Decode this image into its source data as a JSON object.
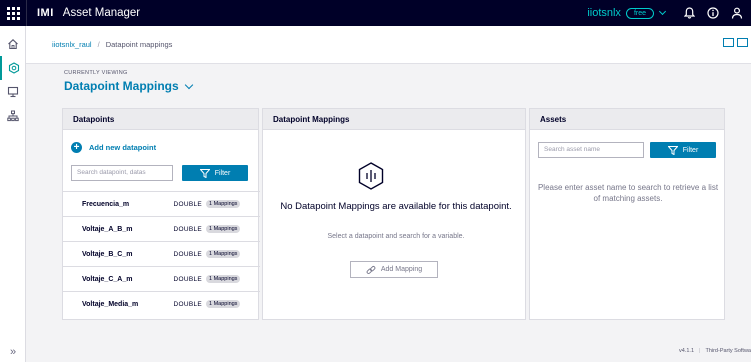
{
  "topbar": {
    "brand": "IMI",
    "app_title": "Asset Manager",
    "tenant": "iiotsnlx",
    "plan_badge": "free"
  },
  "breadcrumb": {
    "root": "iiotsnlx_raul",
    "separator": "/",
    "current": "Datapoint mappings"
  },
  "header": {
    "viewing_label": "CURRENTLY VIEWING",
    "view_title": "Datapoint Mappings"
  },
  "datapoints_panel": {
    "title": "Datapoints",
    "add_label": "Add new datapoint",
    "search_placeholder": "Search datapoint, datas",
    "filter_label": "Filter",
    "rows": [
      {
        "name": "Frecuencia_m",
        "type": "DOUBLE",
        "badge": "1 Mappings"
      },
      {
        "name": "Voltaje_A_B_m",
        "type": "DOUBLE",
        "badge": "1 Mappings"
      },
      {
        "name": "Voltaje_B_C_m",
        "type": "DOUBLE",
        "badge": "1 Mappings"
      },
      {
        "name": "Voltaje_C_A_m",
        "type": "DOUBLE",
        "badge": "1 Mappings"
      },
      {
        "name": "Voltaje_Media_m",
        "type": "DOUBLE",
        "badge": "1 Mappings"
      }
    ]
  },
  "mappings_panel": {
    "title": "Datapoint Mappings",
    "empty_title": "No Datapoint Mappings are available for this datapoint.",
    "empty_sub": "Select a datapoint and search for a variable.",
    "add_mapping_label": "Add Mapping"
  },
  "assets_panel": {
    "title": "Assets",
    "search_placeholder": "Search asset name",
    "filter_label": "Filter",
    "message": "Please enter asset name to search to retrieve a list of matching assets."
  },
  "footer": {
    "version": "v4.1.1",
    "third_party": "Third-Party Softwa"
  },
  "rail": {
    "expand_glyph": "»"
  },
  "icons": {
    "apps": "apps-grid-icon",
    "bell": "bell-icon",
    "info": "info-icon",
    "user": "user-icon",
    "home": "home-icon",
    "asset": "hexagon-icon",
    "mapping": "monitor-icon",
    "hierarchy": "hierarchy-icon"
  },
  "colors": {
    "topbar_bg": "#000028",
    "accent_teal": "#00cccc",
    "primary_blue": "#007eb1",
    "panel_header_bg": "#ebebee",
    "page_bg": "#f3f3f5"
  }
}
